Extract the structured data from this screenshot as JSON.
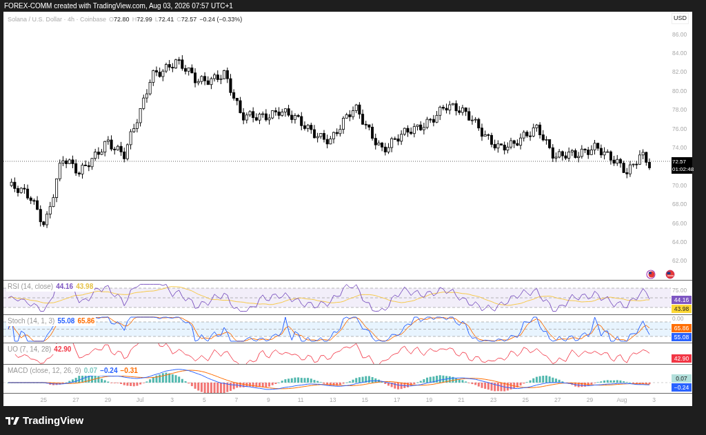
{
  "header": {
    "credit": "FOREX-COMM created with TradingView.com, Aug 03, 2026 07:57 UTC+1"
  },
  "legend": {
    "symbol": "Solana / U.S. Dollar · 4h · Coinbase",
    "ohlc": [
      {
        "label": "O",
        "value": "72.80"
      },
      {
        "label": "H",
        "value": "72.99"
      },
      {
        "label": "L",
        "value": "72.41"
      },
      {
        "label": "C",
        "value": "72.57"
      }
    ],
    "change": "−0.24 (−0.33%)"
  },
  "currency": "USD",
  "price_axis": [
    "86.00",
    "84.00",
    "82.00",
    "80.00",
    "78.00",
    "76.00",
    "74.00",
    "70.00",
    "68.00",
    "66.00",
    "64.00",
    "62.00"
  ],
  "last_price": {
    "value": "72.57",
    "countdown": "01:02:48"
  },
  "indicators": [
    {
      "kind": "rsi",
      "name": "RSI (14, close)",
      "values": [
        {
          "text": "44.16",
          "color": "#7e57c2"
        },
        {
          "text": "43.98",
          "color": "#e6c34a"
        }
      ],
      "axis": [
        "75.00"
      ],
      "badges": [
        {
          "text": "44.16",
          "color": "#7e57c2"
        },
        {
          "text": "43.98",
          "color": "#fdd835"
        }
      ]
    },
    {
      "kind": "stoch",
      "name": "Stoch (14, 1, 3)",
      "values": [
        {
          "text": "55.08",
          "color": "#2962ff"
        },
        {
          "text": "65.86",
          "color": "#ff6d00"
        }
      ],
      "axis": [
        "0.00"
      ],
      "badges": [
        {
          "text": "65.86",
          "color": "#ff6d00"
        },
        {
          "text": "55.08",
          "color": "#2962ff"
        }
      ]
    },
    {
      "kind": "uo",
      "name": "UO (7, 14, 28)",
      "values": [
        {
          "text": "42.90",
          "color": "#f23645"
        }
      ],
      "badges": [
        {
          "text": "42.90",
          "color": "#f23645"
        }
      ]
    },
    {
      "kind": "macd",
      "name": "MACD (close, 12, 26, 9)",
      "values": [
        {
          "text": "0.07",
          "color": "#80cbc4"
        },
        {
          "text": "−0.24",
          "color": "#2962ff"
        },
        {
          "text": "−0.31",
          "color": "#ff6d00"
        }
      ],
      "badges": [
        {
          "text": "0.07",
          "color": "#b2dfdb"
        },
        {
          "text": "−0.24",
          "color": "#2962ff"
        }
      ]
    }
  ],
  "time_axis": [
    "25",
    "27",
    "29",
    "Jul",
    "3",
    "5",
    "7",
    "9",
    "11",
    "13",
    "15",
    "17",
    "19",
    "21",
    "23",
    "25",
    "27",
    "29",
    "Aug",
    "3"
  ],
  "brand": "TradingView"
}
